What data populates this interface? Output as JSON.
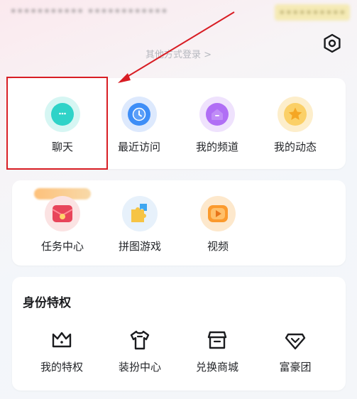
{
  "header": {
    "blurred_left": "•••••••••••   ••••••••••••",
    "blurred_right": "••••••••••",
    "other_login": "其他方式登录 >",
    "settings_icon": "hexagon-settings-icon"
  },
  "quick_actions": {
    "items": [
      {
        "label": "聊天",
        "icon": "chat-bubble-icon"
      },
      {
        "label": "最近访问",
        "icon": "clock-icon"
      },
      {
        "label": "我的频道",
        "icon": "home-channel-icon"
      },
      {
        "label": "我的动态",
        "icon": "star-icon"
      }
    ]
  },
  "features": {
    "items": [
      {
        "label": "任务中心",
        "icon": "task-envelope-icon"
      },
      {
        "label": "拼图游戏",
        "icon": "puzzle-icon"
      },
      {
        "label": "视频",
        "icon": "video-play-icon"
      }
    ]
  },
  "privileges": {
    "title": "身份特权",
    "items": [
      {
        "label": "我的特权",
        "icon": "crown-icon"
      },
      {
        "label": "装扮中心",
        "icon": "tshirt-icon"
      },
      {
        "label": "兑换商城",
        "icon": "shop-icon"
      },
      {
        "label": "富豪团",
        "icon": "diamond-icon"
      }
    ]
  },
  "colors": {
    "highlight": "#d81d24",
    "chat": "#2fd3c8",
    "recent": "#3e8ef7",
    "channel": "#b06ef5",
    "dynamic": "#f7b52c"
  }
}
